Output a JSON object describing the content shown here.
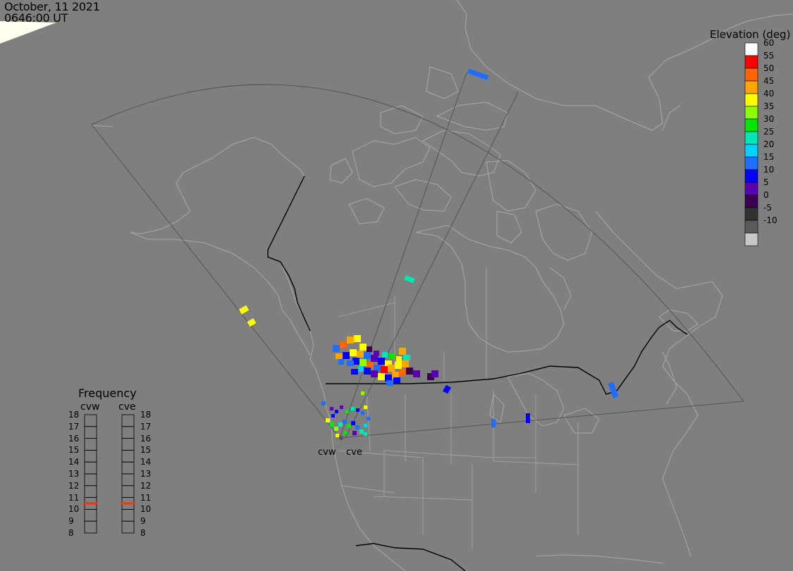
{
  "header": {
    "date": "October, 11 2021",
    "time": "0646:00 UT"
  },
  "colors": {
    "background": "#7f7f7f",
    "coastline": "#a8a8a8",
    "border": "#000000",
    "fov_line": "#555555",
    "daylight": "#fffff0",
    "frequency_marker": "#ff3300"
  },
  "elevation_scale": {
    "title": "Elevation (deg)",
    "levels": [
      {
        "label": "60",
        "color": "#ffffff"
      },
      {
        "label": "55",
        "color": "#ff0000"
      },
      {
        "label": "50",
        "color": "#ff6600"
      },
      {
        "label": "45",
        "color": "#ffa500"
      },
      {
        "label": "40",
        "color": "#ffff00"
      },
      {
        "label": "35",
        "color": "#8cff00"
      },
      {
        "label": "30",
        "color": "#00e600"
      },
      {
        "label": "25",
        "color": "#00e6b4"
      },
      {
        "label": "20",
        "color": "#00d2ff"
      },
      {
        "label": "15",
        "color": "#1e6eff"
      },
      {
        "label": "10",
        "color": "#0000ff"
      },
      {
        "label": "5",
        "color": "#5a00b4"
      },
      {
        "label": "0",
        "color": "#3c0050"
      },
      {
        "label": "-5",
        "color": "#323232"
      },
      {
        "label": "-10",
        "color": "#5a5a5a"
      },
      {
        "label": "",
        "color": "#c8c8c8"
      }
    ]
  },
  "frequency": {
    "title": "Frequency",
    "radars": [
      {
        "name": "cvw",
        "current_mhz": 10.5
      },
      {
        "name": "cve",
        "current_mhz": 10.5
      }
    ],
    "scale": [
      "18",
      "17",
      "16",
      "15",
      "14",
      "13",
      "12",
      "11",
      "10",
      "9",
      "8"
    ]
  },
  "radar_sites": [
    {
      "name": "cvw"
    },
    {
      "name": "cve"
    }
  ],
  "map_features": {
    "icons": [
      "daylight-terminator",
      "radar-fov-fan",
      "coastline",
      "country-border",
      "state-province-borders"
    ]
  }
}
